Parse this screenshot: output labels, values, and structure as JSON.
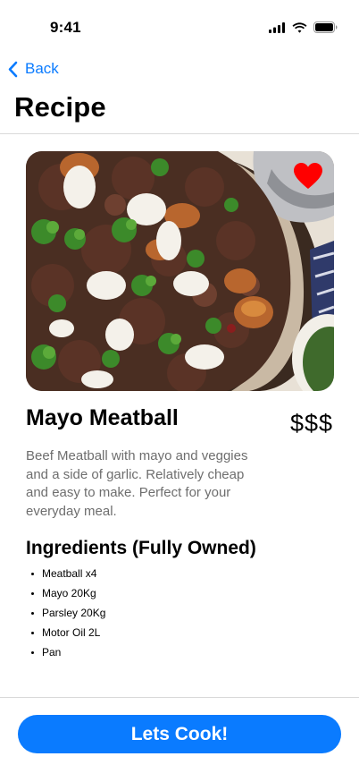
{
  "status_bar": {
    "time": "9:41"
  },
  "nav": {
    "back_label": "Back",
    "title": "Recipe"
  },
  "recipe": {
    "name": "Mayo Meatball",
    "price": "$$$",
    "description": "Beef Meatball with mayo and veggies and a side of garlic. Relatively cheap and easy to make. Perfect for your everyday meal.",
    "favorite": true,
    "ingredients_title": "Ingredients (Fully Owned)",
    "ingredients": [
      "Meatball x4",
      "Mayo 20Kg",
      "Parsley 20Kg",
      "Motor Oil 2L",
      "Pan"
    ]
  },
  "footer": {
    "cta_label": "Lets Cook!"
  },
  "colors": {
    "accent": "#0a7bff",
    "favorite": "#ff0000",
    "description_text": "#6e6e6e"
  }
}
